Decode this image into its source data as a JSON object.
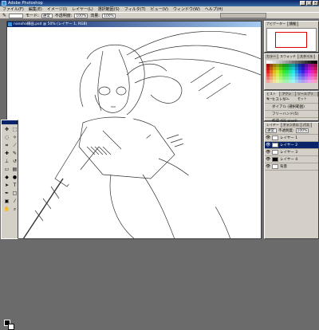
{
  "window": {
    "title": "Adobe Photoshop",
    "minimize": "_",
    "maximize": "□",
    "close": "×"
  },
  "menu": [
    "ファイル(F)",
    "編集(E)",
    "イメージ(I)",
    "レイヤー(L)",
    "選択範囲(S)",
    "フィルタ(T)",
    "ビュー(V)",
    "ウィンドウ(W)",
    "ヘルプ(H)"
  ],
  "options": {
    "mode_label": "モード:",
    "mode_value": "通常",
    "opacity_label": "不透明度:",
    "opacity_value": "100%",
    "flow_label": "流量:",
    "flow_value": "100%"
  },
  "document": {
    "title": "nanoha線画.psd @ 50% (レイヤー 1, RGB)"
  },
  "navigator": {
    "tabs": [
      "ナビゲーター",
      "情報"
    ]
  },
  "color_panel": {
    "tabs": [
      "カラー",
      "スウォッチ",
      "スタイル"
    ]
  },
  "history": {
    "tabs": [
      "ヒストリー",
      "アクション",
      "ツールプリセット"
    ],
    "items": [
      "ヒストリー",
      "ダイアル (選択範囲)",
      "フリーハンド(5)",
      "作成 (SS pixel)"
    ]
  },
  "layers": {
    "tabs": [
      "レイヤー",
      "チャンネル",
      "パス"
    ],
    "mode": "通常",
    "opacity_label": "不透明度:",
    "opacity_value": "100%",
    "items": [
      {
        "name": "レイヤー 1",
        "selected": false,
        "dark": false
      },
      {
        "name": "レイヤー 2",
        "selected": true,
        "dark": false
      },
      {
        "name": "レイヤー 3",
        "selected": false,
        "dark": false
      },
      {
        "name": "レイヤー 4",
        "selected": false,
        "dark": true
      },
      {
        "name": "背景",
        "selected": false,
        "dark": false
      }
    ]
  },
  "tools": [
    "move-icon",
    "marquee-icon",
    "lasso-icon",
    "magic-wand-icon",
    "crop-icon",
    "slice-icon",
    "heal-icon",
    "brush-icon",
    "stamp-icon",
    "history-brush-icon",
    "eraser-icon",
    "gradient-icon",
    "blur-icon",
    "dodge-icon",
    "path-select-icon",
    "type-icon",
    "pen-icon",
    "shape-icon",
    "notes-icon",
    "eyedropper-icon",
    "hand-icon",
    "zoom-icon"
  ],
  "status": {
    "zoom": "50%"
  }
}
